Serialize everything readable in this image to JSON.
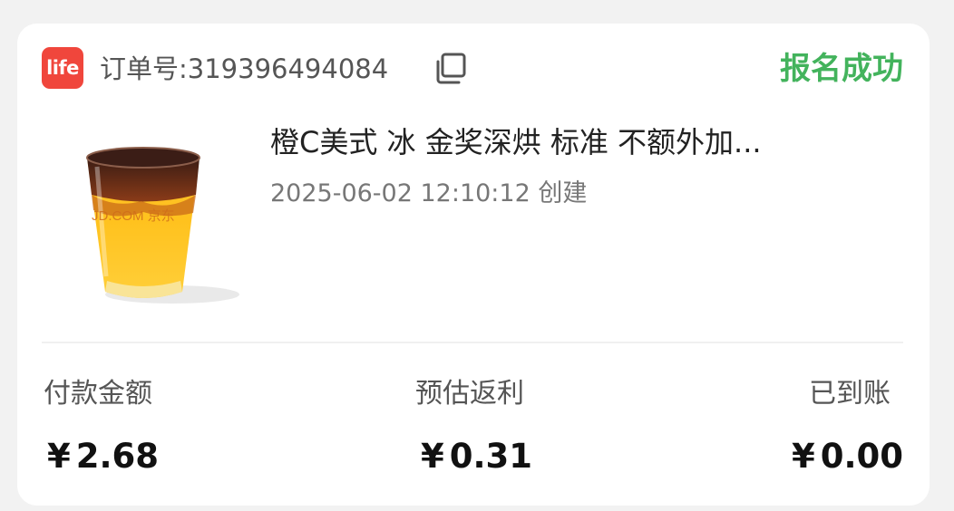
{
  "header": {
    "logo_text": "life",
    "order_number": "订单号:319396494084",
    "status": "报名成功",
    "status_color": "#43b35c",
    "copy_icon": "copy-icon"
  },
  "product": {
    "image_icon": "iced-coffee-orange-drink",
    "watermark": "JD.COM 京东",
    "title": "橙C美式 冰 金奖深烘 标准 不额外加...",
    "created": "2025-06-02 12:10:12 创建"
  },
  "summary": {
    "paid_label": "付款金额",
    "paid_currency": "¥",
    "paid_value": "2.68",
    "rebate_label": "预估返利",
    "rebate_currency": "¥",
    "rebate_value": "0.31",
    "received_label": "已到账",
    "received_currency": "¥",
    "received_value": "0.00"
  }
}
